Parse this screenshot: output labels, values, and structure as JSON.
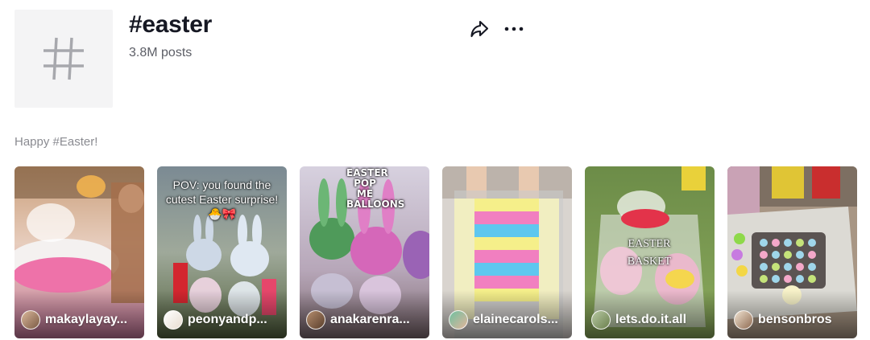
{
  "header": {
    "title": "#easter",
    "posts_count": "3.8M posts",
    "share_icon": "share-icon",
    "more_icon": "more-icon"
  },
  "description": "Happy #Easter!",
  "videos": [
    {
      "username": "makaylayay...",
      "overlay": "",
      "colors": {
        "top": "#b98a66",
        "mid": "#e88db3",
        "bottom": "#c07a8a"
      }
    },
    {
      "username": "peonyandp...",
      "overlay": "POV: you found the cutest Easter surprise! 🐣🎀",
      "colors": {
        "top": "#6b7a86",
        "mid": "#b6c4b0",
        "bottom": "#5d6c45"
      }
    },
    {
      "username": "anakarenra...",
      "overlay": "EASTER POP ME BALLOONS",
      "colors": {
        "top": "#c8bfd6",
        "mid": "#c77fb8",
        "bottom": "#8d6f7a"
      }
    },
    {
      "username": "elainecarols...",
      "overlay": "",
      "colors": {
        "top": "#cfcac4",
        "mid": "#9fd0e8",
        "bottom": "#e9e4a3"
      }
    },
    {
      "username": "lets.do.it.all",
      "overlay": "EASTER BASKET",
      "colors": {
        "top": "#6f8a4c",
        "mid": "#e7c9d8",
        "bottom": "#7a9a55"
      }
    },
    {
      "username": "bensonbros",
      "overlay": "",
      "colors": {
        "top": "#8f7e6a",
        "mid": "#d7d5cf",
        "bottom": "#a69886"
      }
    }
  ]
}
